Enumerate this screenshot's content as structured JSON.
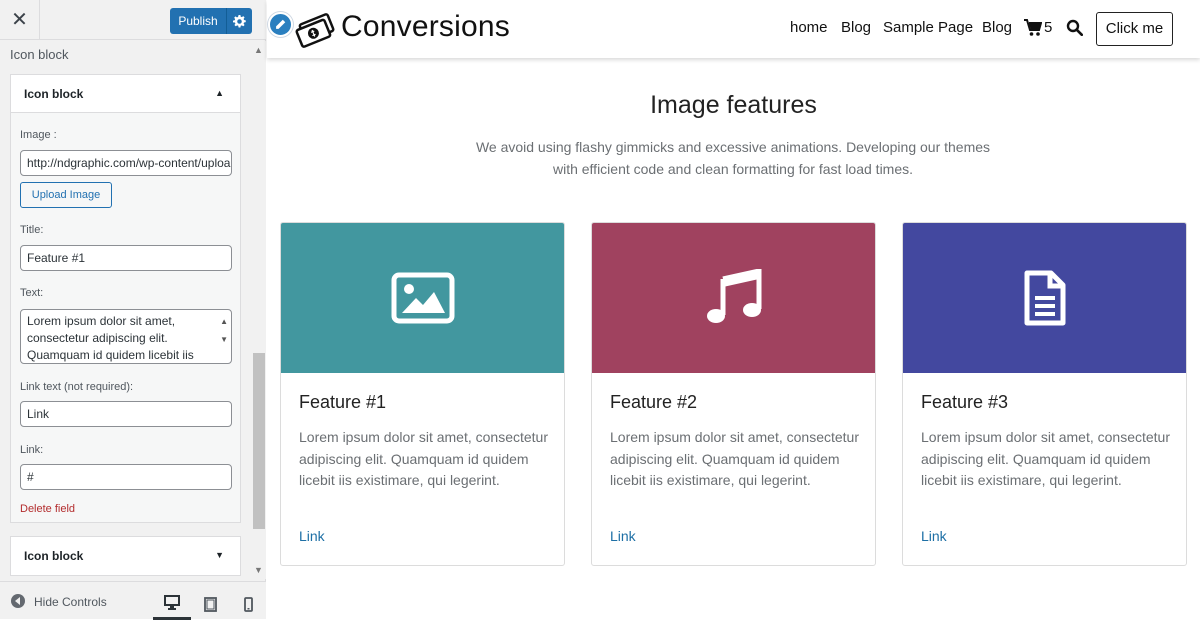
{
  "sidebar": {
    "close_glyph": "✕",
    "publish_label": "Publish",
    "section_title": "Icon block",
    "panel1": {
      "header_label": "Icon block",
      "image_label": "Image :",
      "image_value": "http://ndgraphic.com/wp-content/uploads",
      "upload_label": "Upload Image",
      "title_label": "Title:",
      "title_value": "Feature #1",
      "text_label": "Text:",
      "text_line1": "Lorem ipsum dolor sit amet,",
      "text_line2": "consectetur adipiscing elit.",
      "text_line3": "Quamquam id quidem licebit iis",
      "link_text_label": "Link text (not required):",
      "link_text_value": "Link",
      "link_label": "Link:",
      "link_value": "#",
      "delete_label": "Delete field"
    },
    "panel2": {
      "header_label": "Icon block"
    },
    "footer": {
      "hide_label": "Hide Controls"
    }
  },
  "preview": {
    "site_title": "Conversions",
    "nav": {
      "home": "home",
      "blog1": "Blog",
      "sample": "Sample Page",
      "blog2": "Blog"
    },
    "cart_count": "5",
    "cta_label": "Click me",
    "section_title": "Image features",
    "section_sub": "We avoid using flashy gimmicks and excessive animations. Developing our themes with efficient code and clean formatting for fast load times.",
    "cards": [
      {
        "title": "Feature #1",
        "text": "Lorem ipsum dolor sit amet, consectetur adipiscing elit. Quamquam id quidem licebit iis existimare, qui legerint.",
        "link": "Link",
        "color": "#42979f",
        "icon": "image-icon"
      },
      {
        "title": "Feature #2",
        "text": "Lorem ipsum dolor sit amet, consectetur adipiscing elit. Quamquam id quidem licebit iis existimare, qui legerint.",
        "link": "Link",
        "color": "#a0425f",
        "icon": "music-icon"
      },
      {
        "title": "Feature #3",
        "text": "Lorem ipsum dolor sit amet, consectetur adipiscing elit. Quamquam id quidem licebit iis existimare, qui legerint.",
        "link": "Link",
        "color": "#43489f",
        "icon": "document-icon"
      }
    ]
  },
  "colors": {
    "accent": "#2271b1",
    "link": "#1d6fa5",
    "delete": "#b32d2e"
  }
}
